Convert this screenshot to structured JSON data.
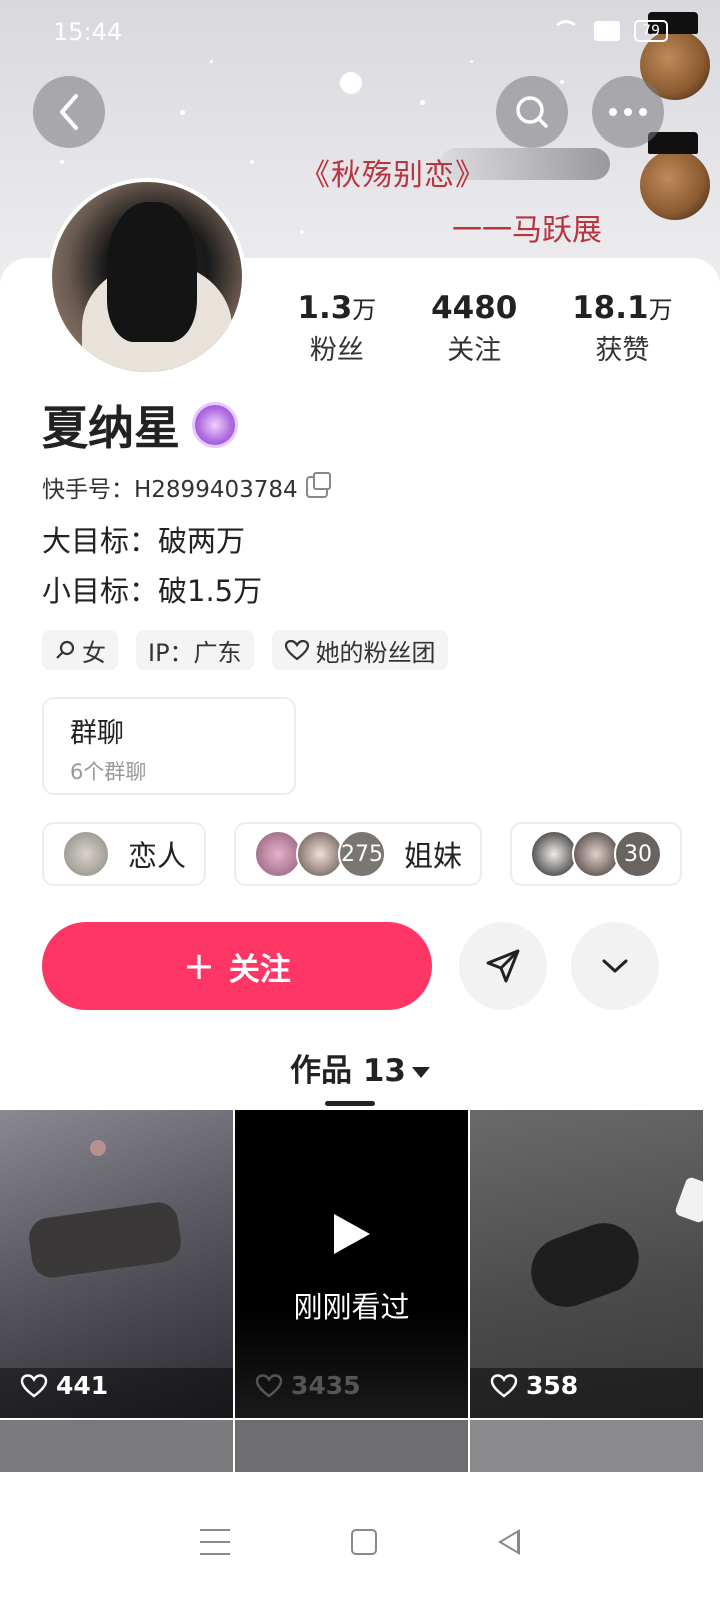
{
  "status_bar": {
    "time": "15:44",
    "battery": "79"
  },
  "banner": {
    "title": "《秋殇别恋》",
    "subtitle": "一一马跃展"
  },
  "profile": {
    "name": "夏纳星",
    "id_label": "快手号：H2899403784",
    "bio_lines": [
      "大目标：破两万",
      "小目标：破1.5万"
    ]
  },
  "stats": [
    {
      "value": "1.3",
      "unit": "万",
      "label": "粉丝"
    },
    {
      "value": "4480",
      "unit": "",
      "label": "关注"
    },
    {
      "value": "18.1",
      "unit": "万",
      "label": "获赞"
    }
  ],
  "tags": [
    {
      "icon": "female-icon",
      "label": "女"
    },
    {
      "icon": "",
      "label": "IP：广东"
    },
    {
      "icon": "fan-club-heart-icon",
      "label": "她的粉丝团"
    }
  ],
  "group": {
    "title": "群聊",
    "subtitle": "6个群聊"
  },
  "relations": [
    {
      "label": "恋人",
      "count": ""
    },
    {
      "label": "姐妹",
      "count": "275"
    },
    {
      "label": "",
      "count": "30"
    }
  ],
  "actions": {
    "follow": "关注"
  },
  "works_tab": {
    "label": "作品 13"
  },
  "videos": [
    {
      "likes": "441",
      "watched": ""
    },
    {
      "likes": "3435",
      "watched": "刚刚看过"
    },
    {
      "likes": "358",
      "watched": ""
    }
  ],
  "colors": {
    "accent": "#fe3666"
  }
}
